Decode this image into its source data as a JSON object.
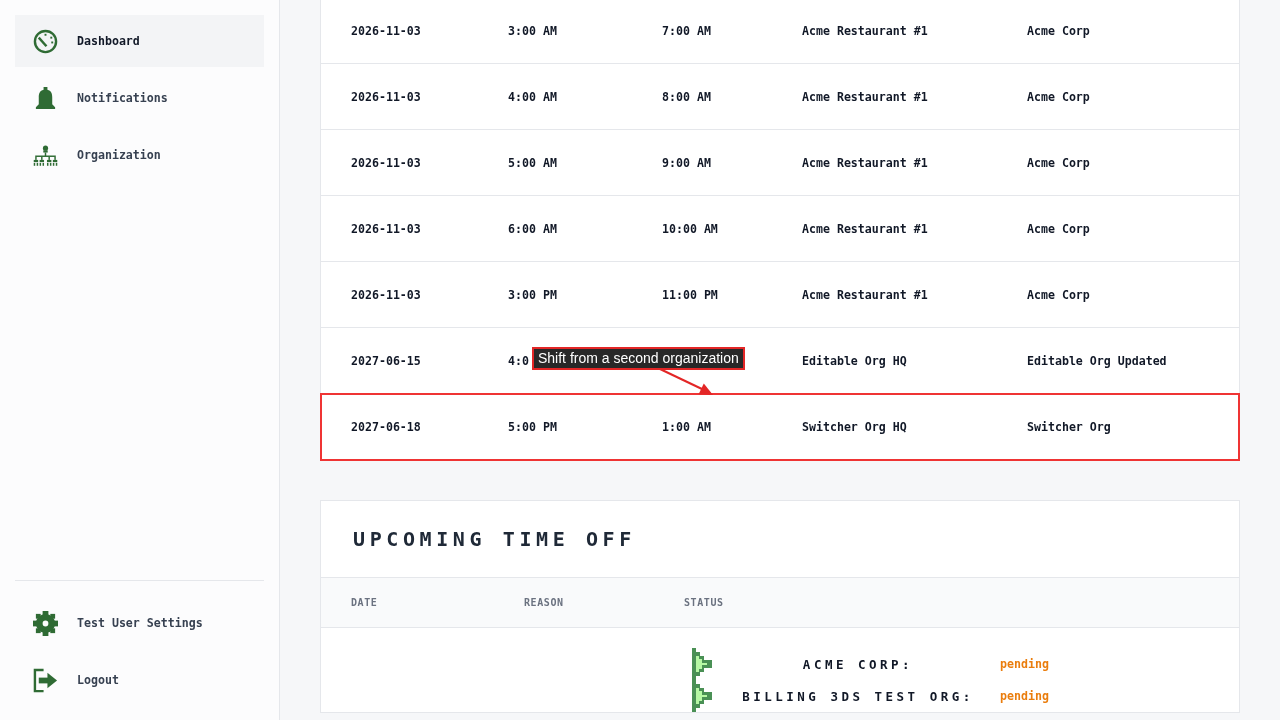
{
  "sidebar": {
    "items": [
      {
        "label": "Dashboard",
        "selected": true
      },
      {
        "label": "Notifications",
        "selected": false
      },
      {
        "label": "Organization",
        "selected": false
      }
    ],
    "footer_items": [
      {
        "label": "Test User Settings"
      },
      {
        "label": "Logout"
      }
    ]
  },
  "shifts_table": {
    "rows": [
      {
        "date": "2026-11-03",
        "start": "3:00 AM",
        "end": "7:00 AM",
        "location": "Acme Restaurant #1",
        "organization": "Acme Corp",
        "highlighted": false
      },
      {
        "date": "2026-11-03",
        "start": "4:00 AM",
        "end": "8:00 AM",
        "location": "Acme Restaurant #1",
        "organization": "Acme Corp",
        "highlighted": false
      },
      {
        "date": "2026-11-03",
        "start": "5:00 AM",
        "end": "9:00 AM",
        "location": "Acme Restaurant #1",
        "organization": "Acme Corp",
        "highlighted": false
      },
      {
        "date": "2026-11-03",
        "start": "6:00 AM",
        "end": "10:00 AM",
        "location": "Acme Restaurant #1",
        "organization": "Acme Corp",
        "highlighted": false
      },
      {
        "date": "2026-11-03",
        "start": "3:00 PM",
        "end": "11:00 PM",
        "location": "Acme Restaurant #1",
        "organization": "Acme Corp",
        "highlighted": false
      },
      {
        "date": "2027-06-15",
        "start": "4:0",
        "location": "Editable Org HQ",
        "organization": "Editable Org Updated",
        "highlighted": false
      },
      {
        "date": "2027-06-18",
        "start": "5:00 PM",
        "end": "1:00 AM",
        "location": "Switcher Org HQ",
        "organization": "Switcher Org",
        "highlighted": true
      }
    ]
  },
  "annotation": {
    "text": "Shift from a second organization"
  },
  "time_off": {
    "title": "UPCOMING TIME OFF",
    "columns": [
      "DATE",
      "REASON",
      "STATUS"
    ],
    "statuses": [
      {
        "organization": "ACME CORP:",
        "status": "pending"
      },
      {
        "organization": "BILLING 3DS TEST ORG:",
        "status": "pending"
      }
    ]
  }
}
